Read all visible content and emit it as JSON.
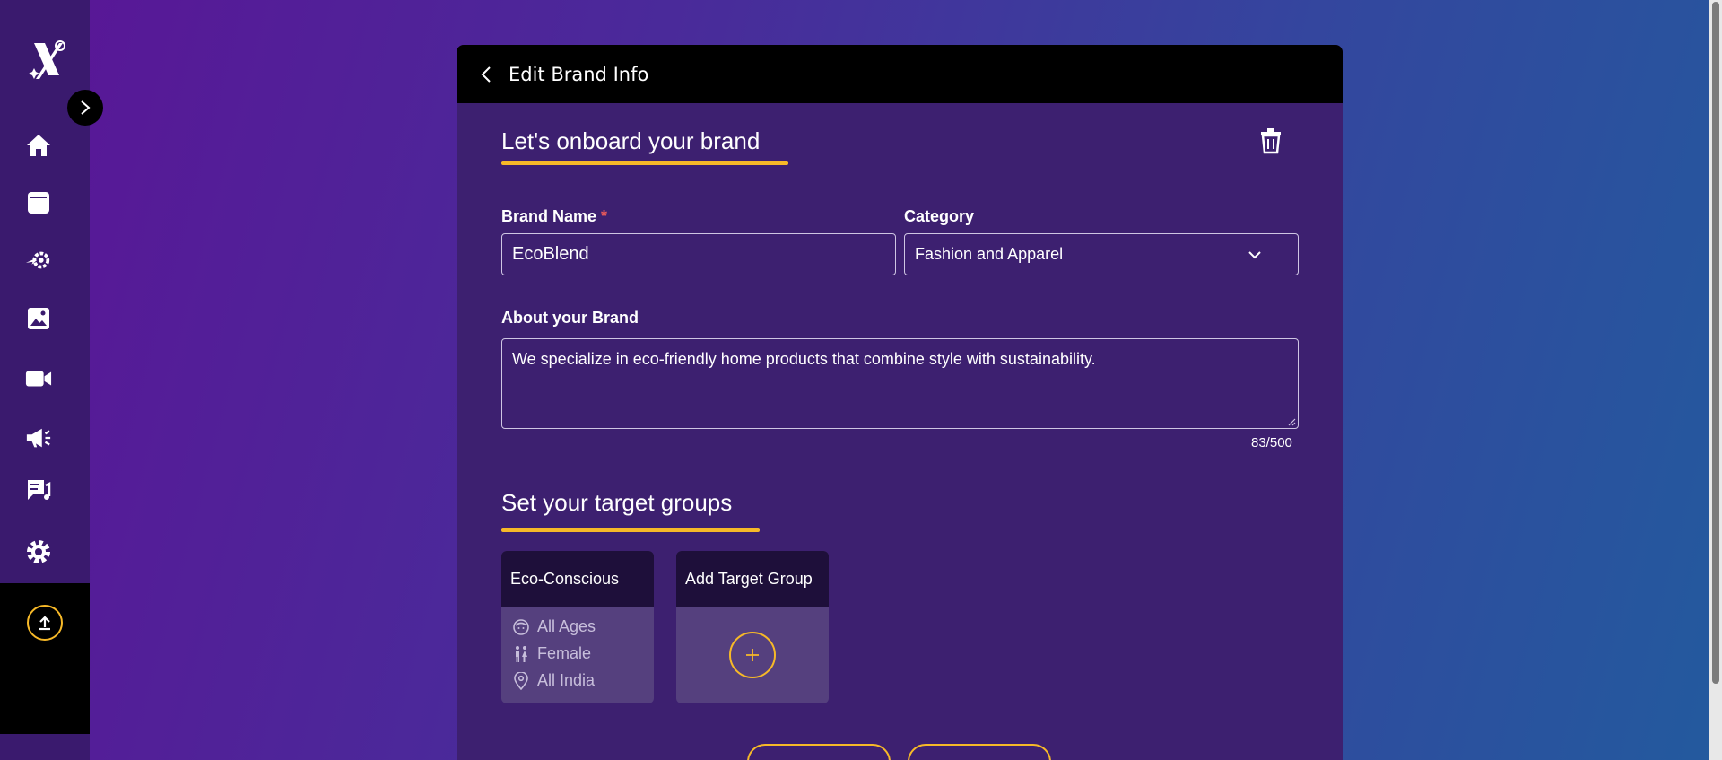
{
  "header": {
    "title": "Edit Brand Info"
  },
  "onboard": {
    "title": "Let's onboard your brand"
  },
  "form": {
    "brand_name_label": "Brand Name",
    "required_mark": "*",
    "brand_name_value": "EcoBlend",
    "category_label": "Category",
    "category_value": "Fashion and Apparel",
    "about_label": "About your Brand",
    "about_value": "We specialize in eco-friendly home products that combine style with sustainability.",
    "about_counter": "83/500"
  },
  "targets": {
    "title": "Set your target groups",
    "groups": [
      {
        "name": "Eco-Conscious",
        "age": "All Ages",
        "gender": "Female",
        "location": "All India"
      }
    ],
    "add_label": "Add Target Group"
  },
  "sidebar": {
    "icons": [
      "home-icon",
      "layers-icon",
      "automation-icon",
      "image-icon",
      "video-icon",
      "megaphone-icon",
      "music-chat-icon",
      "gear-icon"
    ]
  },
  "colors": {
    "accent": "#f7b928",
    "card": "#3d2070",
    "header": "#000000"
  }
}
